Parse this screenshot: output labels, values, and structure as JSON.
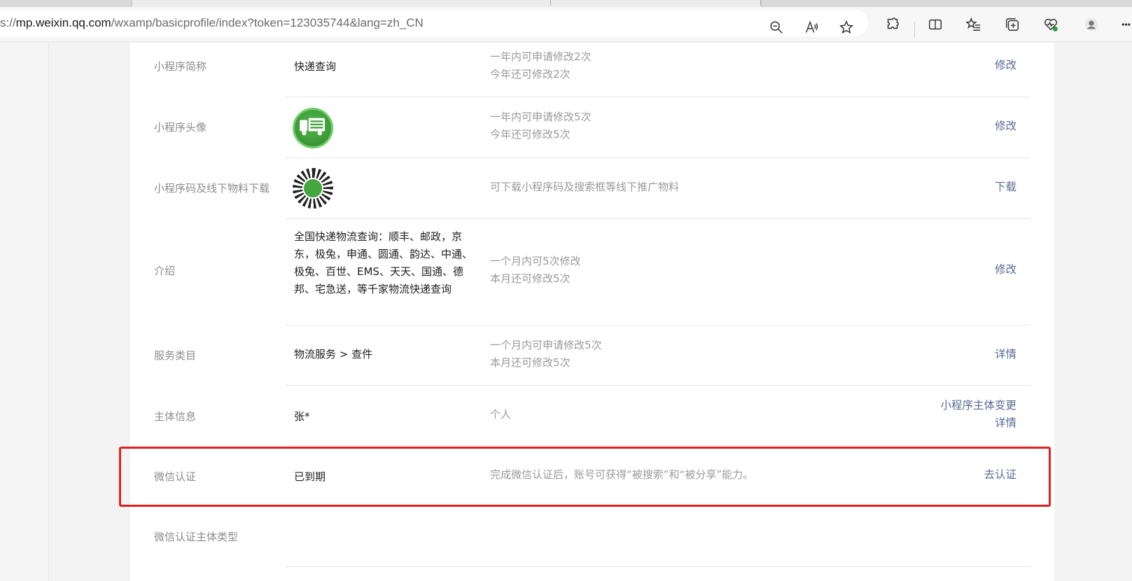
{
  "browser": {
    "url_prefix": "s://",
    "url_host": "mp.weixin.qq.com",
    "url_path": "/wxamp/basicprofile/index?token=123035744&lang=zh_CN"
  },
  "rows": [
    {
      "label": "小程序简称",
      "value": "快递查询",
      "tips": [
        "一年内可申请修改2次",
        "今年还可修改2次"
      ],
      "actions": [
        "修改"
      ]
    },
    {
      "label": "小程序头像",
      "tips": [
        "一年内可申请修改5次",
        "今年还可修改5次"
      ],
      "actions": [
        "修改"
      ]
    },
    {
      "label": "小程序码及线下物料下载",
      "tips": [
        "可下载小程序码及搜索框等线下推广物料"
      ],
      "actions": [
        "下载"
      ]
    },
    {
      "label": "介绍",
      "value": "全国快递物流查询：顺丰、邮政，京东，极兔，申通、圆通、韵达、中通、极兔、百世、EMS、天天、国通、德邦、宅急送，等千家物流快递查询",
      "tips": [
        "一个月内可5次修改",
        "本月还可修改5次"
      ],
      "actions": [
        "修改"
      ]
    },
    {
      "label": "服务类目",
      "value": "物流服务 > 查件",
      "tips": [
        "一个月内可申请修改5次",
        "本月还可修改5次"
      ],
      "actions": [
        "详情"
      ]
    },
    {
      "label": "主体信息",
      "value": "张*",
      "tips": [
        "个人"
      ],
      "actions": [
        "小程序主体变更",
        "详情"
      ]
    },
    {
      "label": "微信认证",
      "value": "已到期",
      "tips": [
        "完成微信认证后，账号可获得“被搜索”和“被分享”能力。"
      ],
      "actions": [
        "去认证"
      ]
    },
    {
      "label": "微信认证主体类型"
    }
  ],
  "colors": {
    "link": "#576b95",
    "highlight": "#e02020",
    "avatar_green": "#43a63e"
  }
}
